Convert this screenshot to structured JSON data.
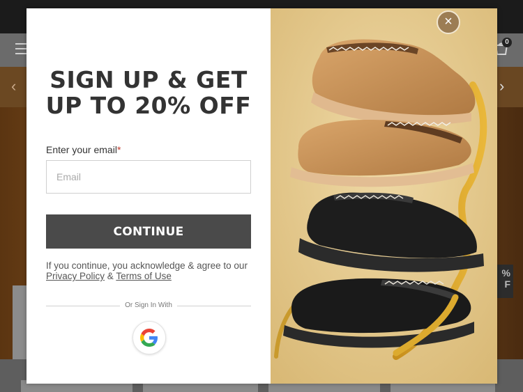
{
  "background": {
    "cart_count": "0",
    "promo_fragment": "%\nF",
    "icons": [
      "menu-icon",
      "cart-icon",
      "chevron-left-icon",
      "chevron-right-icon"
    ]
  },
  "modal": {
    "headline": "SIGN UP & GET UP TO 20% OFF",
    "email_label": "Enter your email",
    "email_required_marker": "*",
    "email_placeholder": "Email",
    "email_value": "",
    "continue_label": "CONTINUE",
    "legal_prefix": "If you continue, you acknowledge & agree to our",
    "privacy_link": "Privacy Policy",
    "legal_and": "&",
    "terms_link": "Terms of Use",
    "or_sign_in": "Or Sign In With",
    "social_provider": "google-icon",
    "close_symbol": "×"
  },
  "colors": {
    "button": "#4a4a4a",
    "headline": "#333333",
    "image_background": "#e2c68a",
    "required": "#c0392b"
  }
}
